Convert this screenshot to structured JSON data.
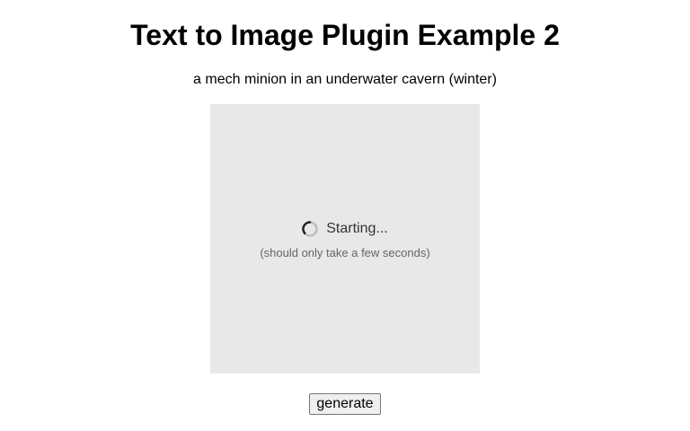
{
  "page": {
    "title": "Text to Image Plugin Example 2",
    "prompt": "a mech minion in an underwater cavern (winter)"
  },
  "image_panel": {
    "status": "Starting...",
    "hint": "(should only take a few seconds)",
    "spinner_icon": "loading-spinner-icon",
    "background_color": "#e8e8e8"
  },
  "actions": {
    "generate_label": "generate"
  }
}
